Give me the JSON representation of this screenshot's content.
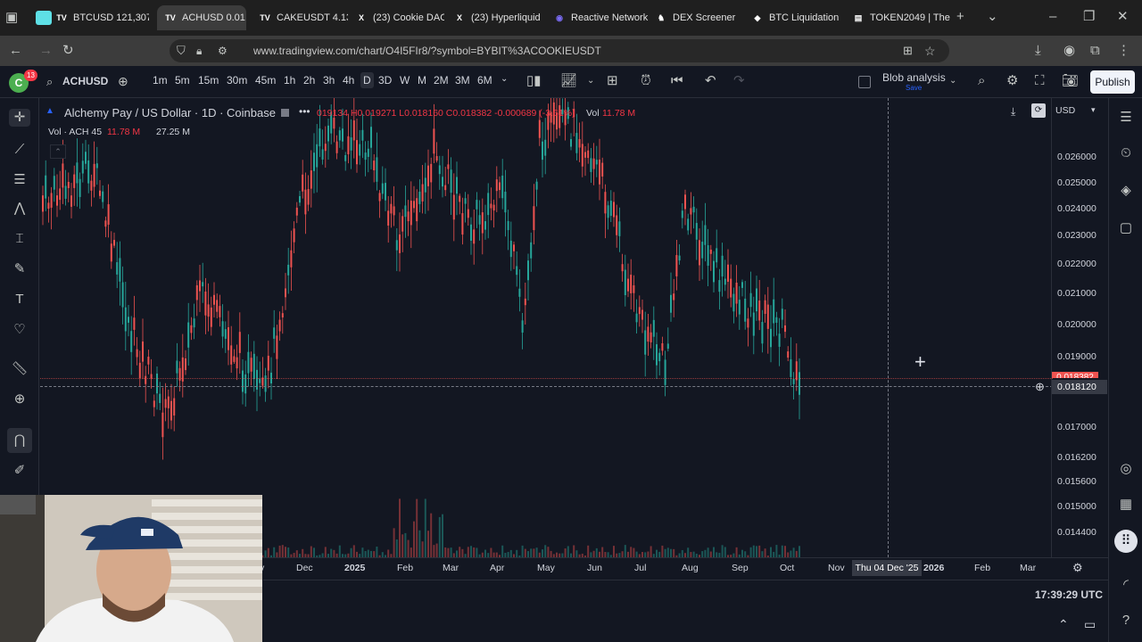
{
  "browser": {
    "tabs": [
      {
        "label": "BTCUSD 121,307",
        "icon": "tradingview-icon",
        "color": "#e3e3e3"
      },
      {
        "label": "ACHUSD 0.01…",
        "icon": "tradingview-icon",
        "color": "#e3e3e3",
        "active": true
      },
      {
        "label": "CAKEUSDT 4.130",
        "icon": "tradingview-icon",
        "color": "#e3e3e3"
      },
      {
        "label": "(23) Cookie DAO",
        "icon": "x-icon",
        "color": "#e3e3e3"
      },
      {
        "label": "(23) Hyperliquid",
        "icon": "x-icon",
        "color": "#e3e3e3"
      },
      {
        "label": "Reactive Network",
        "icon": "reactive-icon",
        "color": "#e3e3e3"
      },
      {
        "label": "DEX Screener",
        "icon": "dexscreener-icon",
        "color": "#e3e3e3"
      },
      {
        "label": "BTC Liquidation L",
        "icon": "coinglass-icon",
        "color": "#e3e3e3"
      },
      {
        "label": "TOKEN2049 | The",
        "icon": "token-icon",
        "color": "#e3e3e3"
      }
    ],
    "url": "www.tradingview.com/chart/O4I5FIr8/?symbol=BYBIT%3ACOOKIEUSDT"
  },
  "toolbar": {
    "avatar_letter": "C",
    "notif_count": "13",
    "symbol": "ACHUSD",
    "intervals": [
      "1m",
      "5m",
      "15m",
      "30m",
      "45m",
      "1h",
      "2h",
      "3h",
      "4h",
      "D",
      "3D",
      "W",
      "M",
      "2M",
      "3M",
      "6M"
    ],
    "active_interval": "D",
    "layout_name": "Blob analysis",
    "layout_status": "Save",
    "publish_label": "Publish"
  },
  "legend": {
    "title": "Alchemy Pay / US Dollar · 1D · Coinbase",
    "ohlc": "019134 H0.019271 L0.018160 C0.018382 -0.000689 (-3.61%)",
    "vol_label": "Vol",
    "vol_value": "11.78 M",
    "vol_row_label": "Vol · ACH 45",
    "vol_row_v1": "11.78 M",
    "vol_row_v2": "27.25 M",
    "currency": "USD"
  },
  "price_axis": {
    "ticks": [
      "0.026000",
      "0.025000",
      "0.024000",
      "0.023000",
      "0.022000",
      "0.021000",
      "0.020000",
      "0.019000",
      "0.017000",
      "0.016200",
      "0.015600",
      "0.015000",
      "0.014400"
    ],
    "last_price": "0.018382",
    "crosshair_price": "0.018120"
  },
  "time_axis": {
    "ticks": [
      "v",
      "Dec",
      "2025",
      "Feb",
      "Mar",
      "Apr",
      "May",
      "Jun",
      "Jul",
      "Aug",
      "Sep",
      "Oct",
      "Nov",
      "2026",
      "Feb",
      "Mar"
    ],
    "crosshair_date": "Thu 04 Dec '25"
  },
  "clock": "17:39:29 UTC",
  "colors": {
    "up": "#26a69a",
    "down": "#ef5350",
    "bg": "#131722",
    "accent": "#2962ff"
  }
}
